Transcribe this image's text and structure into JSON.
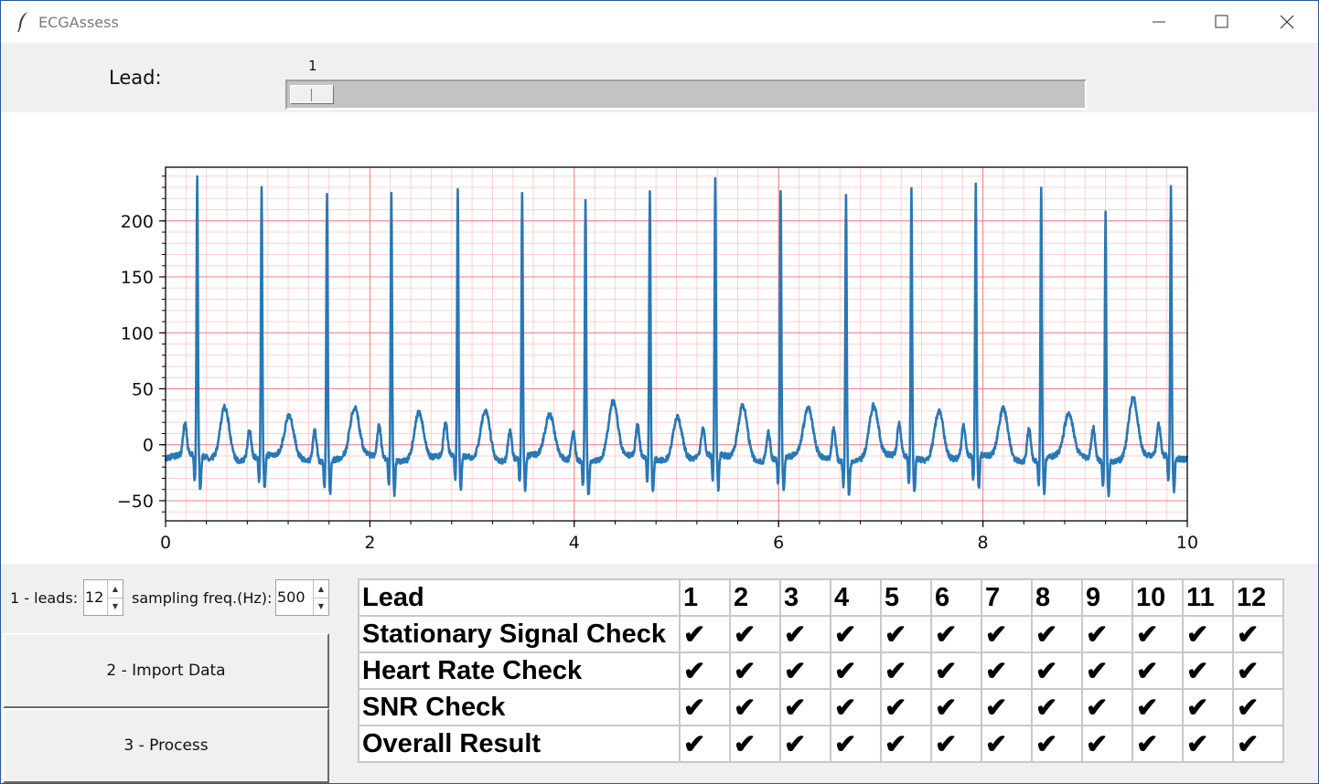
{
  "window": {
    "title": "ECGAssess",
    "minimize_icon": "minimize-icon",
    "maximize_icon": "maximize-icon",
    "close_icon": "close-icon"
  },
  "lead_selector": {
    "label": "Lead:",
    "value": "1",
    "min": 1,
    "max": 12
  },
  "chart_data": {
    "type": "line",
    "x_ticks": [
      "0",
      "2",
      "4",
      "6",
      "8",
      "10"
    ],
    "y_ticks": [
      "200",
      "150",
      "100",
      "50",
      "0",
      "−50"
    ],
    "xlim": [
      0,
      10
    ],
    "ylim": [
      -68,
      248
    ],
    "grid": "ECG paper grid (major and minor red lines)",
    "series_color": "#2878b5",
    "grid_major_color": "#f08080",
    "grid_minor_color": "#ffd0d0",
    "r_peaks": [
      {
        "t": 0.31,
        "amp": 236
      },
      {
        "t": 0.94,
        "amp": 228
      },
      {
        "t": 1.58,
        "amp": 228
      },
      {
        "t": 2.21,
        "amp": 228
      },
      {
        "t": 2.86,
        "amp": 228
      },
      {
        "t": 3.49,
        "amp": 225
      },
      {
        "t": 4.11,
        "amp": 223
      },
      {
        "t": 4.74,
        "amp": 228
      },
      {
        "t": 5.38,
        "amp": 235
      },
      {
        "t": 6.02,
        "amp": 228
      },
      {
        "t": 6.66,
        "amp": 228
      },
      {
        "t": 7.3,
        "amp": 228
      },
      {
        "t": 7.93,
        "amp": 228
      },
      {
        "t": 8.57,
        "amp": 231
      },
      {
        "t": 9.2,
        "amp": 212
      },
      {
        "t": 9.84,
        "amp": 228
      }
    ],
    "t_wave_amp": [
      38,
      26,
      33,
      33,
      35,
      27,
      39,
      29,
      38,
      33,
      36,
      35,
      35,
      27,
      44,
      25
    ],
    "p_wave_amp": [
      15,
      12,
      13,
      14,
      15,
      12,
      12,
      13,
      12,
      12,
      14,
      14,
      14,
      15,
      14,
      13
    ],
    "baseline": -12
  },
  "controls": {
    "leads_label": "1 - leads:",
    "leads_value": "12",
    "freq_label": "sampling freq.(Hz):",
    "freq_value": "500",
    "import_label": "2 - Import Data",
    "process_label": "3 - Process"
  },
  "results_table": {
    "header": "Lead",
    "leads": [
      "1",
      "2",
      "3",
      "4",
      "5",
      "6",
      "7",
      "8",
      "9",
      "10",
      "11",
      "12"
    ],
    "rows": [
      {
        "name": "Stationary Signal Check",
        "values": [
          "✔",
          "✔",
          "✔",
          "✔",
          "✔",
          "✔",
          "✔",
          "✔",
          "✔",
          "✔",
          "✔",
          "✔"
        ]
      },
      {
        "name": "Heart Rate Check",
        "values": [
          "✔",
          "✔",
          "✔",
          "✔",
          "✔",
          "✔",
          "✔",
          "✔",
          "✔",
          "✔",
          "✔",
          "✔"
        ]
      },
      {
        "name": "SNR Check",
        "values": [
          "✔",
          "✔",
          "✔",
          "✔",
          "✔",
          "✔",
          "✔",
          "✔",
          "✔",
          "✔",
          "✔",
          "✔"
        ]
      },
      {
        "name": "Overall Result",
        "values": [
          "✔",
          "✔",
          "✔",
          "✔",
          "✔",
          "✔",
          "✔",
          "✔",
          "✔",
          "✔",
          "✔",
          "✔"
        ]
      }
    ]
  }
}
